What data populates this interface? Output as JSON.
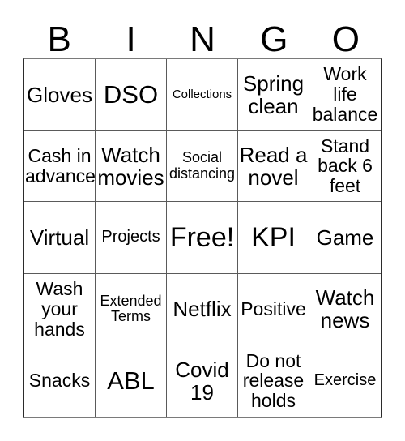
{
  "card": {
    "header_letters": [
      "B",
      "I",
      "N",
      "G",
      "O"
    ],
    "rows": [
      [
        {
          "text": "Gloves",
          "size": "lg"
        },
        {
          "text": "DSO",
          "size": "xl"
        },
        {
          "text": "Collections",
          "size": "xxs"
        },
        {
          "text": "Spring\nclean",
          "size": "lg"
        },
        {
          "text": "Work\nlife\nbalance",
          "size": "md"
        }
      ],
      [
        {
          "text": "Cash in\nadvance",
          "size": "md"
        },
        {
          "text": "Watch\nmovies",
          "size": "lg"
        },
        {
          "text": "Social\ndistancing",
          "size": "xs"
        },
        {
          "text": "Read a\nnovel",
          "size": "lg"
        },
        {
          "text": "Stand\nback 6\nfeet",
          "size": "md"
        }
      ],
      [
        {
          "text": "Virtual",
          "size": "lg"
        },
        {
          "text": "Projects",
          "size": "sm"
        },
        {
          "text": "Free!",
          "size": "xxl"
        },
        {
          "text": "KPI",
          "size": "xxl"
        },
        {
          "text": "Game",
          "size": "lg"
        }
      ],
      [
        {
          "text": "Wash\nyour\nhands",
          "size": "md"
        },
        {
          "text": "Extended\nTerms",
          "size": "xs"
        },
        {
          "text": "Netflix",
          "size": "lg"
        },
        {
          "text": "Positive",
          "size": "md"
        },
        {
          "text": "Watch\nnews",
          "size": "lg"
        }
      ],
      [
        {
          "text": "Snacks",
          "size": "md"
        },
        {
          "text": "ABL",
          "size": "xl"
        },
        {
          "text": "Covid\n19",
          "size": "lg"
        },
        {
          "text": "Do not\nrelease\nholds",
          "size": "md"
        },
        {
          "text": "Exercise",
          "size": "sm"
        }
      ]
    ]
  },
  "colors": {
    "background": "#ffffff",
    "text": "#000000",
    "grid_line": "#5a5a5a",
    "grid_outer": "#2b2b2b"
  }
}
